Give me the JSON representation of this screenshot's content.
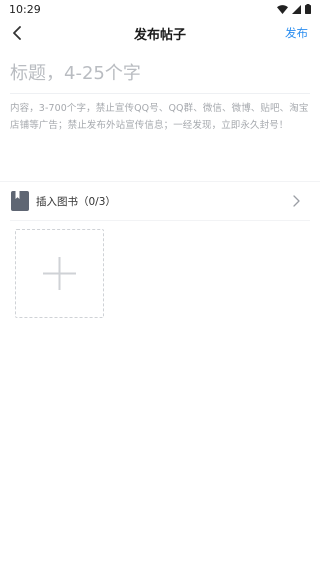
{
  "status_bar": {
    "time": "10:29"
  },
  "header": {
    "title": "发布帖子",
    "publish_label": "发布",
    "accent_color": "#2b8ef0"
  },
  "form": {
    "title_placeholder": "标题，4-25个字",
    "title_value": "",
    "content_placeholder": "内容，3-700个字，禁止宣传QQ号、QQ群、微信、微博、贴吧、淘宝店铺等广告；禁止发布外站宣传信息；一经发现，立即永久封号！",
    "content_value": ""
  },
  "insert_book": {
    "label": "插入图书（0/3）"
  },
  "icons": {
    "back": "back-arrow-icon",
    "book": "book-icon",
    "chevron": "chevron-right-icon",
    "add": "plus-icon",
    "wifi": "wifi-icon",
    "signal": "signal-icon",
    "battery": "battery-icon"
  }
}
